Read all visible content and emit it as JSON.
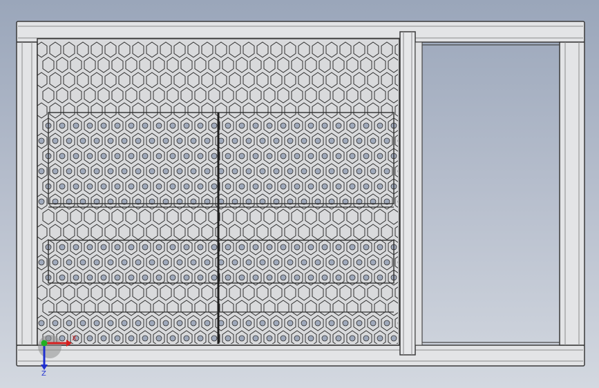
{
  "viewport": {
    "background_top": "#9aa6ba",
    "background_bottom": "#d3d8e0",
    "frame_fill": "#e3e4e6",
    "frame_edge": "#3a3a3a",
    "mesh_fill": "#d9dadc",
    "mesh_edge": "#2e2e2e",
    "hole_fill": "#9fa9bb"
  },
  "triad": {
    "x_label": "X",
    "y_label": "Y",
    "z_label": "Z",
    "x_color": "#d62020",
    "y_color": "#22b022",
    "z_color": "#2030d0"
  }
}
